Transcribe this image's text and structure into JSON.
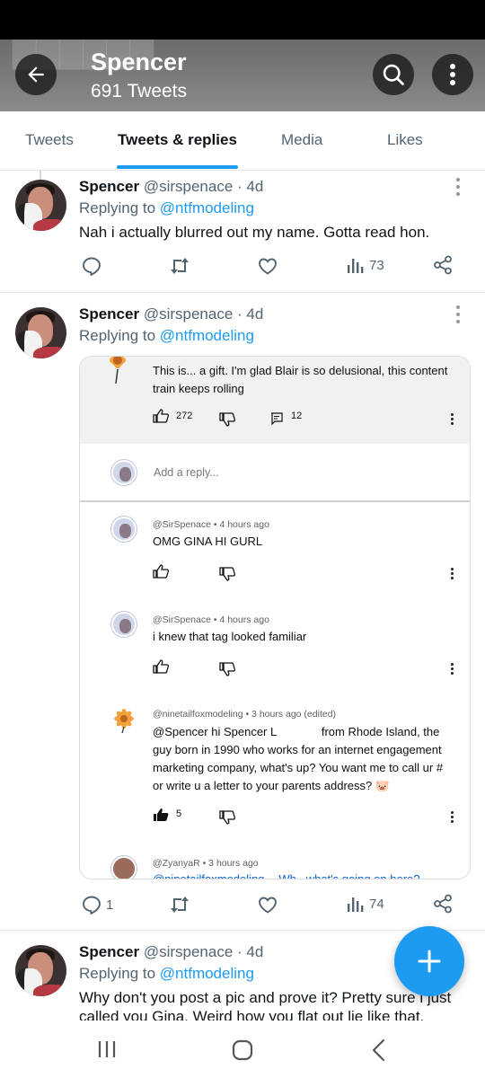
{
  "header": {
    "title": "Spencer",
    "subtitle": "691 Tweets"
  },
  "tabs": [
    {
      "label": "Tweets"
    },
    {
      "label": "Tweets & replies",
      "active": true
    },
    {
      "label": "Media"
    },
    {
      "label": "Likes"
    }
  ],
  "tweets": [
    {
      "name": "Spencer",
      "handle": "@sirspenace · 4d",
      "replying_prefix": "Replying to ",
      "replying_to": "@ntfmodeling",
      "text": "Nah i actually blurred out my name. Gotta read hon.",
      "replies": "",
      "retweets": "",
      "likes": "",
      "views": "73"
    },
    {
      "name": "Spencer",
      "handle": "@sirspenace · 4d",
      "replying_prefix": "Replying to ",
      "replying_to": "@ntfmodeling",
      "replies": "1",
      "retweets": "",
      "likes": "",
      "views": "74"
    },
    {
      "name": "Spencer",
      "handle": "@sirspenace · 4d",
      "replying_prefix": "Replying to ",
      "replying_to": "@ntfmodeling",
      "text": "Why don't you post a pic and prove it? Pretty sure i just called you Gina. Weird how you flat out lie like that. Almost"
    }
  ],
  "embedded": {
    "top_comment": {
      "text": "This is... a gift.   I'm glad Blair is so delusional, this content train keeps rolling",
      "likes": "272",
      "replies": "12"
    },
    "add_reply_placeholder": "Add a reply...",
    "replies": [
      {
        "meta": "@SirSpenace  •  4 hours ago",
        "text": "OMG GINA HI GURL",
        "likes": ""
      },
      {
        "meta": "@SirSpenace  •  4 hours ago",
        "text": "i knew that tag looked familiar",
        "likes": ""
      },
      {
        "meta": "@ninetailfoxmodeling  •  3 hours ago (edited)",
        "text_a": "@Spencer  hi Spencer L",
        "text_b": " from Rhode Island, the guy born in 1990 who works for an internet engagement marketing company, what's up?  You want me to call ur # or write u a letter to your parents address? 🐷",
        "likes": "5"
      },
      {
        "meta": "@ZyanyaR  •  3 hours ago",
        "text": "@ninetailfoxmodeling  ·· Wh.. what's going on here? ··"
      }
    ]
  },
  "colors": {
    "accent": "#1d9bf0",
    "text_primary": "#0f1419",
    "text_secondary": "#536471"
  },
  "icons": [
    "back-arrow-icon",
    "search-icon",
    "more-vertical-icon",
    "reply-icon",
    "retweet-icon",
    "like-icon",
    "views-icon",
    "share-icon",
    "plus-icon"
  ]
}
